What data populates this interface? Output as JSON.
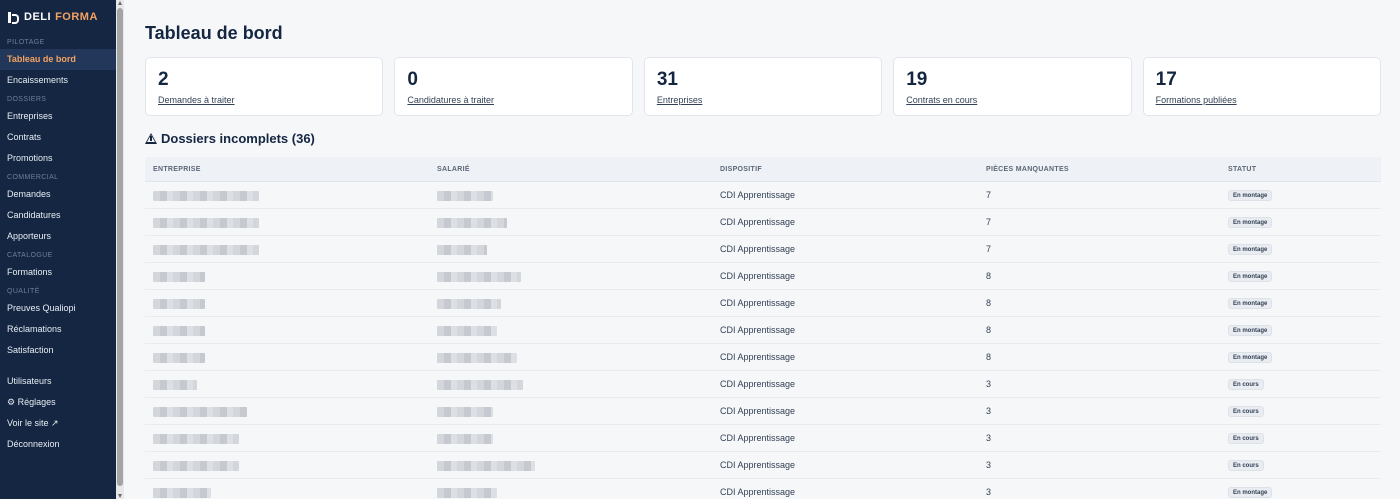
{
  "brand": {
    "part1": "DELI",
    "part2": "FORMA"
  },
  "sidebar": {
    "sections": {
      "pilotage": "PILOTAGE",
      "dossiers": "DOSSIERS",
      "commercial": "COMMERCIAL",
      "catalogue": "CATALOGUE",
      "qualite": "QUALITÉ"
    },
    "items": {
      "tableau": "Tableau de bord",
      "encaissements": "Encaissements",
      "entreprises": "Entreprises",
      "contrats": "Contrats",
      "promotions": "Promotions",
      "demandes": "Demandes",
      "candidatures": "Candidatures",
      "apporteurs": "Apporteurs",
      "formations": "Formations",
      "preuves": "Preuves Qualiopi",
      "reclamations": "Réclamations",
      "satisfaction": "Satisfaction",
      "utilisateurs": "Utilisateurs",
      "reglages": "⚙ Réglages",
      "voir_site": "Voir le site ↗",
      "deconnexion": "Déconnexion"
    },
    "active": "tableau"
  },
  "page": {
    "title": "Tableau de bord"
  },
  "cards": [
    {
      "value": "2",
      "label": "Demandes à traiter"
    },
    {
      "value": "0",
      "label": "Candidatures à traiter"
    },
    {
      "value": "31",
      "label": "Entreprises"
    },
    {
      "value": "19",
      "label": "Contrats en cours"
    },
    {
      "value": "17",
      "label": "Formations publiées"
    }
  ],
  "incomplete": {
    "title": "Dossiers incomplets (36)",
    "headers": {
      "entreprise": "ENTREPRISE",
      "salarie": "SALARIÉ",
      "dispositif": "DISPOSITIF",
      "pieces": "PIÈCES MANQUANTES",
      "statut": "STATUT"
    },
    "rows": [
      {
        "dispositif": "CDI Apprentissage",
        "pieces": "7",
        "statut": "En montage"
      },
      {
        "dispositif": "CDI Apprentissage",
        "pieces": "7",
        "statut": "En montage"
      },
      {
        "dispositif": "CDI Apprentissage",
        "pieces": "7",
        "statut": "En montage"
      },
      {
        "dispositif": "CDI Apprentissage",
        "pieces": "8",
        "statut": "En montage"
      },
      {
        "dispositif": "CDI Apprentissage",
        "pieces": "8",
        "statut": "En montage"
      },
      {
        "dispositif": "CDI Apprentissage",
        "pieces": "8",
        "statut": "En montage"
      },
      {
        "dispositif": "CDI Apprentissage",
        "pieces": "8",
        "statut": "En montage"
      },
      {
        "dispositif": "CDI Apprentissage",
        "pieces": "3",
        "statut": "En cours"
      },
      {
        "dispositif": "CDI Apprentissage",
        "pieces": "3",
        "statut": "En cours"
      },
      {
        "dispositif": "CDI Apprentissage",
        "pieces": "3",
        "statut": "En cours"
      },
      {
        "dispositif": "CDI Apprentissage",
        "pieces": "3",
        "statut": "En cours"
      },
      {
        "dispositif": "CDI Apprentissage",
        "pieces": "3",
        "statut": "En montage"
      }
    ]
  }
}
